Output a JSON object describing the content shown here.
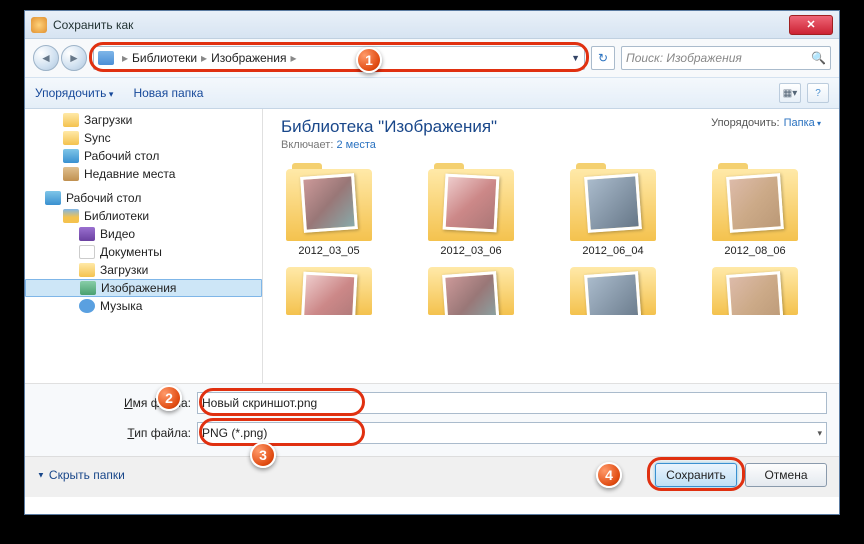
{
  "title": "Сохранить как",
  "breadcrumb": {
    "root": "Библиотеки",
    "current": "Изображения"
  },
  "search": {
    "placeholder": "Поиск: Изображения"
  },
  "toolbar": {
    "organize": "Упорядочить",
    "new_folder": "Новая папка"
  },
  "sidebar": {
    "quick": [
      "Загрузки",
      "Sync",
      "Рабочий стол",
      "Недавние места"
    ],
    "desktop": "Рабочий стол",
    "libraries": "Библиотеки",
    "lib_items": [
      "Видео",
      "Документы",
      "Загрузки",
      "Изображения",
      "Музыка"
    ]
  },
  "library": {
    "title": "Библиотека \"Изображения\"",
    "includes_label": "Включает:",
    "includes_link": "2 места",
    "sort_label": "Упорядочить:",
    "sort_value": "Папка"
  },
  "folders": [
    "2012_03_05",
    "2012_03_06",
    "2012_06_04",
    "2012_08_06"
  ],
  "fields": {
    "filename_label": "Имя файла:",
    "filename_value": "Новый скриншот.png",
    "filetype_label": "Тип файла:",
    "filetype_value": "PNG (*.png)"
  },
  "footer": {
    "hide": "Скрыть папки",
    "save": "Сохранить",
    "cancel": "Отмена"
  },
  "callouts": {
    "c1": "1",
    "c2": "2",
    "c3": "3",
    "c4": "4"
  }
}
